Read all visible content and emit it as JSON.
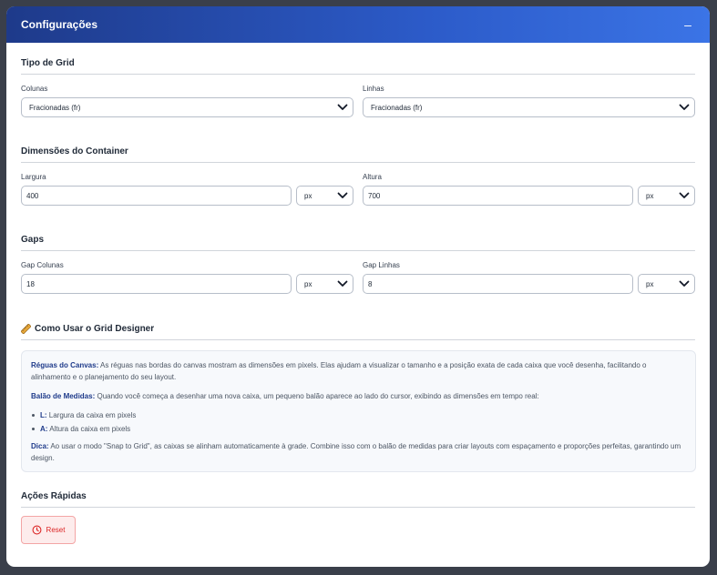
{
  "header": {
    "title": "Configurações",
    "collapse_symbol": "–"
  },
  "grid_type": {
    "title": "Tipo de Grid",
    "columns": {
      "label": "Colunas",
      "value": "Fracionadas (fr)"
    },
    "rows": {
      "label": "Linhas",
      "value": "Fracionadas (fr)"
    }
  },
  "container": {
    "title": "Dimensões do Container",
    "width": {
      "label": "Largura",
      "value": "400",
      "unit": "px"
    },
    "height": {
      "label": "Altura",
      "value": "700",
      "unit": "px"
    }
  },
  "gaps": {
    "title": "Gaps",
    "columns": {
      "label": "Gap Colunas",
      "value": "18",
      "unit": "px"
    },
    "rows": {
      "label": "Gap Linhas",
      "value": "8",
      "unit": "px"
    }
  },
  "help": {
    "title": "Como Usar o Grid Designer",
    "rulers_title": "Réguas do Canvas:",
    "rulers_text": " As réguas nas bordas do canvas mostram as dimensões em pixels. Elas ajudam a visualizar o tamanho e a posição exata de cada caixa que você desenha, facilitando o alinhamento e o planejamento do seu layout.",
    "balloon_title": "Balão de Medidas:",
    "balloon_text": " Quando você começa a desenhar uma nova caixa, um pequeno balão aparece ao lado do cursor, exibindo as dimensões em tempo real:",
    "items": [
      {
        "key": "L:",
        "text": " Largura da caixa em pixels"
      },
      {
        "key": "A:",
        "text": " Altura da caixa em pixels"
      }
    ],
    "tip_title": "Dica:",
    "tip_text": " Ao usar o modo \"Snap to Grid\", as caixas se alinham automaticamente à grade. Combine isso com o balão de medidas para criar layouts com espaçamento e proporções perfeitas, garantindo um design."
  },
  "actions": {
    "title": "Ações Rápidas",
    "reset_label": "Reset"
  },
  "colors": {
    "header_start": "#1e3a8a",
    "header_end": "#3b74e6",
    "danger": "#dc2626"
  }
}
